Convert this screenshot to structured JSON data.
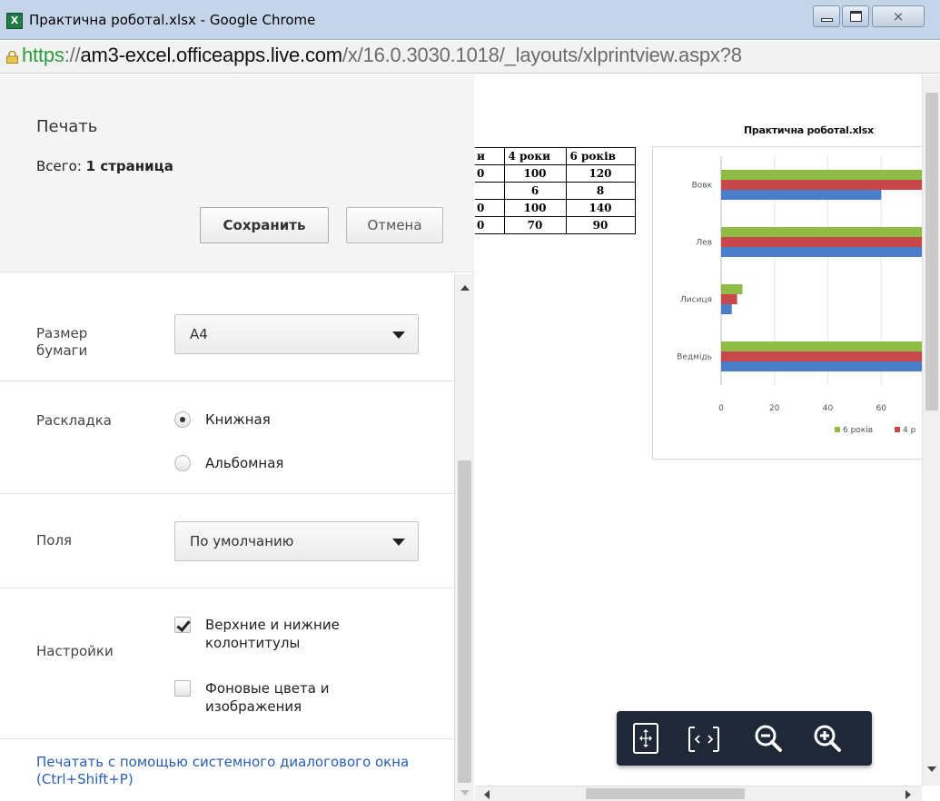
{
  "window": {
    "title": "Практична роботаl.xlsx - Google Chrome",
    "app_icon_text": "X",
    "minimize_icon": "minimize-icon",
    "maximize_icon": "maximize-icon",
    "close_icon": "close-icon",
    "close_glyph": "⨯"
  },
  "address": {
    "scheme": "https",
    "separator": "://",
    "host": "am3-excel.officeapps.live.com",
    "path": "/x/16.0.3030.1018/_layouts/xlprintview.aspx?8"
  },
  "print_panel": {
    "title": "Печать",
    "total_label": "Всего:",
    "total_value": "1 страница",
    "save_label": "Сохранить",
    "cancel_label": "Отмена",
    "paper_size": {
      "label": "Размер бумаги",
      "value": "A4"
    },
    "layout": {
      "label": "Раскладка",
      "options": [
        "Книжная",
        "Альбомная"
      ],
      "selected": "Книжная"
    },
    "margins": {
      "label": "Поля",
      "value": "По умолчанию"
    },
    "options": {
      "label": "Настройки",
      "items": [
        {
          "label": "Верхние и нижние колонтитулы",
          "checked": true
        },
        {
          "label": "Фоновые цвета и изображения",
          "checked": false
        }
      ]
    },
    "system_dialog_link": "Печатать с помощью системного диалогового окна (Ctrl+Shift+P)"
  },
  "preview": {
    "table": {
      "headers": [
        "и",
        "4 роки",
        "6 років"
      ],
      "rows": [
        [
          "0",
          "100",
          "120"
        ],
        [
          "",
          "6",
          "8"
        ],
        [
          "0",
          "100",
          "140"
        ],
        [
          "0",
          "70",
          "90"
        ]
      ]
    },
    "chart_title": "Практична роботаl.xlsx"
  },
  "chart_data": {
    "type": "bar",
    "orientation": "horizontal",
    "title": "Практична роботаl.xlsx",
    "categories": [
      "Вовк",
      "Лев",
      "Лисиця",
      "Ведмідь"
    ],
    "series": [
      {
        "name": "6 років",
        "color": "#8fbc45",
        "values": [
          120,
          120,
          8,
          140
        ]
      },
      {
        "name": "4 роки",
        "color": "#c8474a",
        "values": [
          100,
          100,
          6,
          100
        ]
      },
      {
        "name": "",
        "color": "#4a7ec8",
        "values": [
          60,
          100,
          4,
          100
        ]
      }
    ],
    "legend": [
      "6 років",
      "4 р"
    ],
    "legend_position": "bottom",
    "xticks": [
      "0",
      "20",
      "40",
      "60"
    ],
    "xlim": [
      0,
      80
    ],
    "grid": true
  },
  "zoom_toolbar": {
    "buttons": [
      {
        "name": "fit-page",
        "icon": "fit-page-icon"
      },
      {
        "name": "fit-width",
        "icon": "fit-width-icon"
      },
      {
        "name": "zoom-out",
        "icon": "zoom-out-icon"
      },
      {
        "name": "zoom-in",
        "icon": "zoom-in-icon"
      }
    ]
  },
  "colors": {
    "titlebar": "#c4d5ea",
    "https": "#2a9c3a",
    "link": "#2a5db0",
    "toolbar": "#1e2836"
  }
}
